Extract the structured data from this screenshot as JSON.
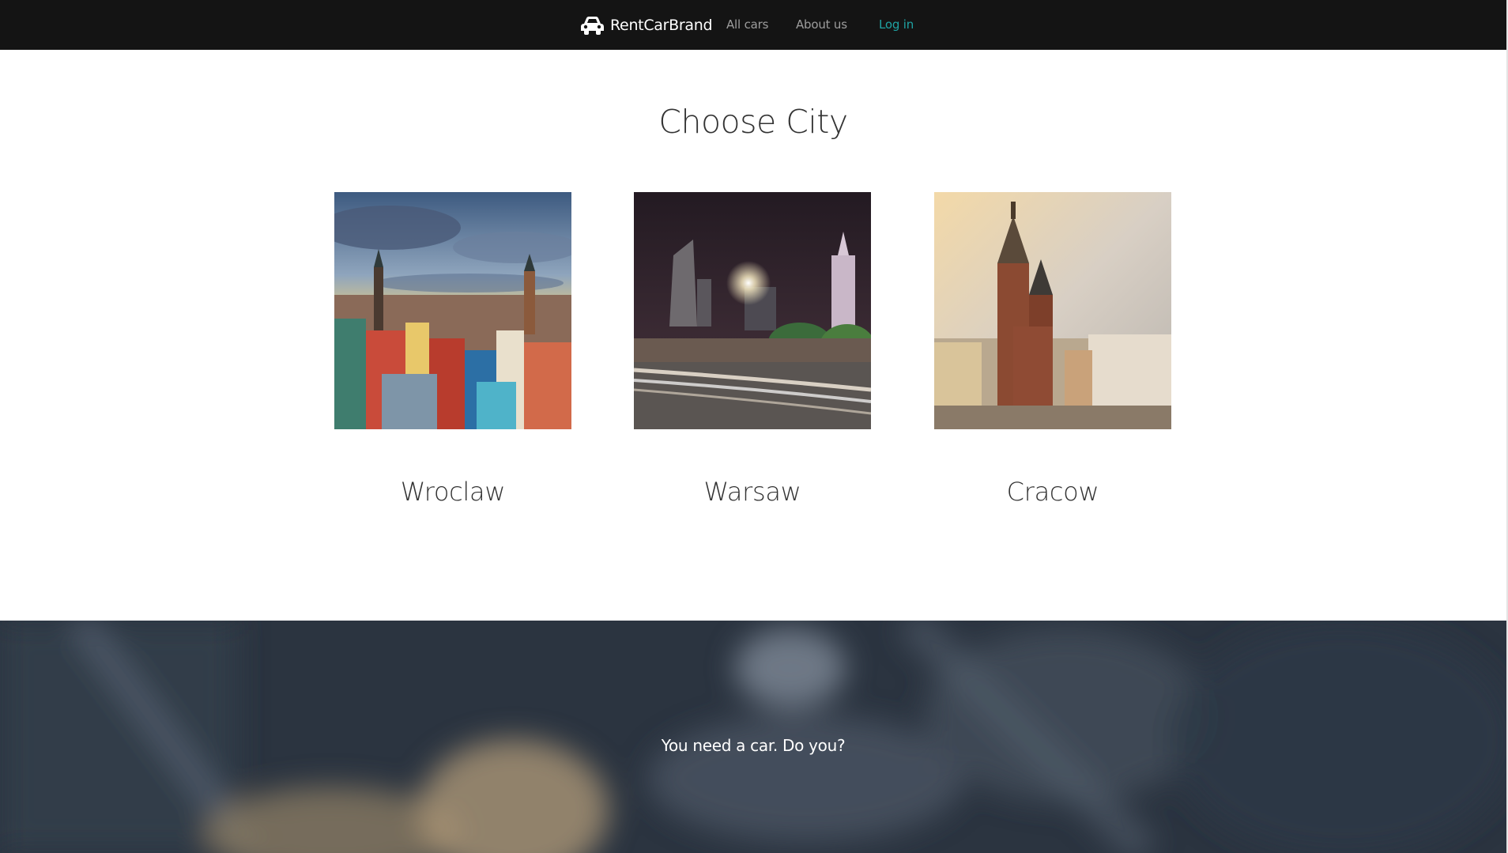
{
  "navbar": {
    "brand": "RentCarBrand",
    "brand_icon": "car-icon",
    "links": [
      {
        "label": "All cars"
      },
      {
        "label": "About us"
      },
      {
        "label": "Log in",
        "color": "#1fa3a3"
      }
    ]
  },
  "main": {
    "title": "Choose City",
    "cities": [
      {
        "name": "Wroclaw"
      },
      {
        "name": "Warsaw"
      },
      {
        "name": "Cracow"
      }
    ]
  },
  "hero": {
    "tagline": "You need a car. Do you?"
  },
  "colors": {
    "navbar_bg": "#141414",
    "accent": "#1fa3a3",
    "hero_bg": "#2b3440"
  }
}
